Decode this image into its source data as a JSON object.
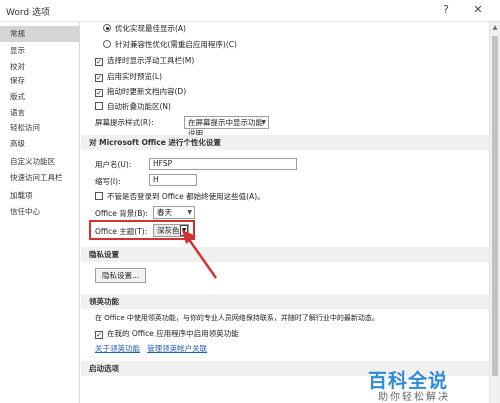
{
  "window": {
    "title": "Word 选项",
    "help_icon": "?",
    "close_icon": "✕"
  },
  "sidebar": {
    "items": [
      {
        "label": "常规",
        "active": true
      },
      {
        "label": "显示"
      },
      {
        "label": "校对"
      },
      {
        "label": "保存"
      },
      {
        "label": "版式"
      },
      {
        "label": "语言"
      },
      {
        "label": "轻松访问"
      },
      {
        "label": "高级"
      },
      {
        "label": "自定义功能区"
      },
      {
        "label": "快速访问工具栏"
      },
      {
        "label": "加载项"
      },
      {
        "label": "信任中心"
      }
    ]
  },
  "ui": {
    "radio_optimize": "优化实现最佳显示(A)",
    "radio_compat": "针对兼容性优化(需重启应用程序)(C)",
    "cb_minitoolbar": "选择时显示浮动工具栏(M)",
    "cb_livepreview": "启用实时预览(L)",
    "cb_dragupdate": "拖动时更新文档内容(D)",
    "cb_collapse": "自动折叠功能区(N)",
    "tooltip_label": "屏幕提示样式(R):",
    "tooltip_value": "在屏幕提示中显示功能说明"
  },
  "personalize": {
    "header": "对 Microsoft Office 进行个性化设置",
    "username_label": "用户名(U):",
    "username_value": "HFSP",
    "initials_label": "缩写(I):",
    "initials_value": "H",
    "always_use_label": "不管是否登录到 Office 都始终使用这些值(A)。",
    "background_label": "Office 背景(B):",
    "background_value": "春天",
    "theme_label": "Office 主题(T):",
    "theme_value": "深灰色"
  },
  "privacy": {
    "header": "隐私设置",
    "button": "隐私设置..."
  },
  "linkedin": {
    "header": "领英功能",
    "description": "在 Office 中使用领英功能，与你的专业人员网络保持联系，并随时了解行业中的最新动态。",
    "enable_label": "在我的 Office 应用程序中启用领英功能",
    "link_about": "关于领英功能",
    "link_manage": "管理领英帐户关联"
  },
  "startup": {
    "header": "启动选项"
  },
  "watermark": {
    "line1": "百科全说",
    "line2": "助你轻松解决"
  },
  "colors": {
    "highlight": "#d23232",
    "link": "#1e5fb3",
    "section_bg": "#f0f0f0"
  }
}
